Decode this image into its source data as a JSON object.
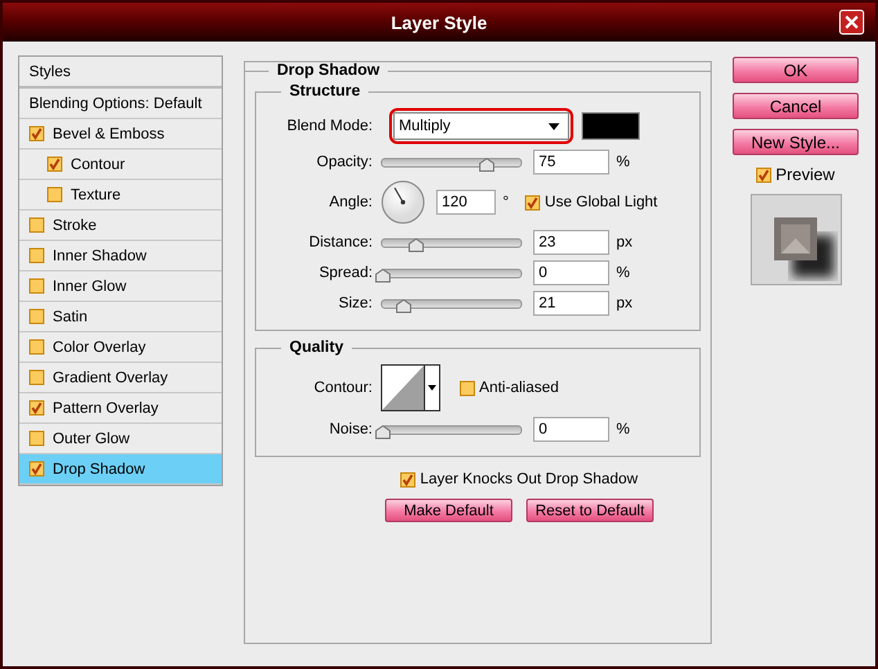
{
  "window": {
    "title": "Layer Style"
  },
  "styles_panel": {
    "header": "Styles",
    "items": [
      {
        "label": "Blending Options: Default",
        "kind": "plain",
        "selected": false
      },
      {
        "label": "Bevel & Emboss",
        "kind": "check",
        "checked": true,
        "selected": false,
        "children": [
          {
            "label": "Contour",
            "kind": "check",
            "checked": true,
            "selected": false
          },
          {
            "label": "Texture",
            "kind": "check",
            "checked": false,
            "selected": false
          }
        ]
      },
      {
        "label": "Stroke",
        "kind": "check",
        "checked": false,
        "selected": false
      },
      {
        "label": "Inner Shadow",
        "kind": "check",
        "checked": false,
        "selected": false
      },
      {
        "label": "Inner Glow",
        "kind": "check",
        "checked": false,
        "selected": false
      },
      {
        "label": "Satin",
        "kind": "check",
        "checked": false,
        "selected": false
      },
      {
        "label": "Color Overlay",
        "kind": "check",
        "checked": false,
        "selected": false
      },
      {
        "label": "Gradient Overlay",
        "kind": "check",
        "checked": false,
        "selected": false
      },
      {
        "label": "Pattern Overlay",
        "kind": "check",
        "checked": true,
        "selected": false
      },
      {
        "label": "Outer Glow",
        "kind": "check",
        "checked": false,
        "selected": false
      },
      {
        "label": "Drop Shadow",
        "kind": "check",
        "checked": true,
        "selected": true
      }
    ]
  },
  "drop_shadow": {
    "title": "Drop Shadow",
    "structure": {
      "title": "Structure",
      "blend_mode": {
        "label": "Blend Mode:",
        "value": "Multiply"
      },
      "rows": [
        {
          "kind": "slider",
          "label": "Opacity:",
          "level": 0.75,
          "value": "75",
          "unit": "%"
        },
        {
          "kind": "angle",
          "label": "Angle:",
          "value": "120",
          "unit": "°",
          "global_light": {
            "label": "Use Global Light",
            "checked": true
          }
        },
        {
          "kind": "slider",
          "label": "Distance:",
          "level": 0.24,
          "value": "23",
          "unit": "px"
        },
        {
          "kind": "slider",
          "label": "Spread:",
          "level": 0,
          "value": "0",
          "unit": "%"
        },
        {
          "kind": "slider",
          "label": "Size:",
          "level": 0.15,
          "value": "21",
          "unit": "px"
        }
      ]
    },
    "quality": {
      "title": "Quality",
      "contour": {
        "label": "Contour:"
      },
      "anti_aliased": {
        "label": "Anti-aliased",
        "checked": false
      },
      "noise": {
        "label": "Noise:",
        "level": 0,
        "value": "0",
        "unit": "%"
      }
    },
    "layer_knocks_out": {
      "label": "Layer Knocks Out Drop Shadow",
      "checked": true
    },
    "buttons": [
      "Make Default",
      "Reset to Default"
    ]
  },
  "side": {
    "buttons": [
      "OK",
      "Cancel",
      "New Style..."
    ],
    "preview": {
      "label": "Preview",
      "checked": true
    }
  }
}
